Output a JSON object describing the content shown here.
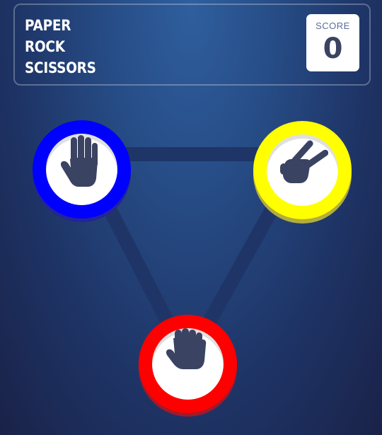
{
  "header": {
    "title_lines": [
      "PAPER",
      "ROCK",
      "SCISSORS"
    ],
    "score_label": "SCORE",
    "score_value": "0"
  },
  "choices": [
    {
      "id": "paper",
      "icon": "paper-hand-icon",
      "ring_color": "#0000ff"
    },
    {
      "id": "scissors",
      "icon": "scissors-hand-icon",
      "ring_color": "#ffff00"
    },
    {
      "id": "rock",
      "icon": "rock-fist-icon",
      "ring_color": "#ff0000"
    }
  ],
  "colors": {
    "hand": "#3b4363",
    "triangle": "#1f3567"
  }
}
